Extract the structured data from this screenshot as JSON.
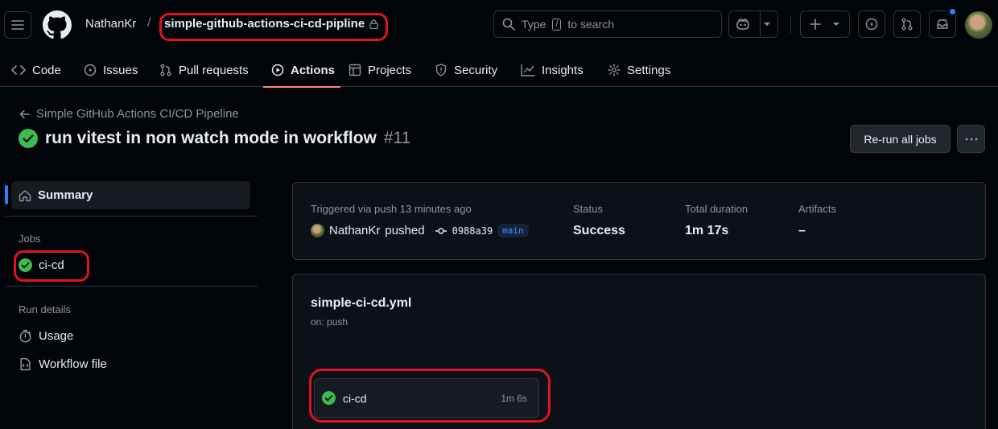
{
  "header": {
    "owner": "NathanKr",
    "slash": "/",
    "repo": "simple-github-actions-ci-cd-pipline",
    "search_type": "Type",
    "search_key": "/",
    "search_suffix": "to search"
  },
  "tabs": [
    {
      "label": "Code",
      "icon": "code-icon"
    },
    {
      "label": "Issues",
      "icon": "issue-icon"
    },
    {
      "label": "Pull requests",
      "icon": "pull-request-icon"
    },
    {
      "label": "Actions",
      "icon": "play-icon",
      "active": true
    },
    {
      "label": "Projects",
      "icon": "table-icon"
    },
    {
      "label": "Security",
      "icon": "shield-icon"
    },
    {
      "label": "Insights",
      "icon": "graph-icon"
    },
    {
      "label": "Settings",
      "icon": "gear-icon"
    }
  ],
  "page": {
    "back_label": "Simple GitHub Actions CI/CD Pipeline",
    "run_title": "run vitest in non watch mode in workflow",
    "run_number": "#11",
    "rerun_label": "Re-run all jobs"
  },
  "sidebar": {
    "summary_label": "Summary",
    "jobs_heading": "Jobs",
    "job_label": "ci-cd",
    "run_details_heading": "Run details",
    "usage_label": "Usage",
    "workflow_file_label": "Workflow file"
  },
  "summary": {
    "triggered": "Triggered via push 13 minutes ago",
    "actor": "NathanKr",
    "action": "pushed",
    "commit": "0988a39",
    "branch": "main",
    "status_label": "Status",
    "status_value": "Success",
    "duration_label": "Total duration",
    "duration_value": "1m 17s",
    "artifacts_label": "Artifacts",
    "artifacts_value": "–"
  },
  "workflow": {
    "file": "simple-ci-cd.yml",
    "trigger": "on: push",
    "job_name": "ci-cd",
    "job_duration": "1m 6s"
  },
  "colors": {
    "success": "#3fb950",
    "accent": "#2f81f7",
    "highlight": "#e0141e",
    "tab_underline": "#fd8c73"
  }
}
